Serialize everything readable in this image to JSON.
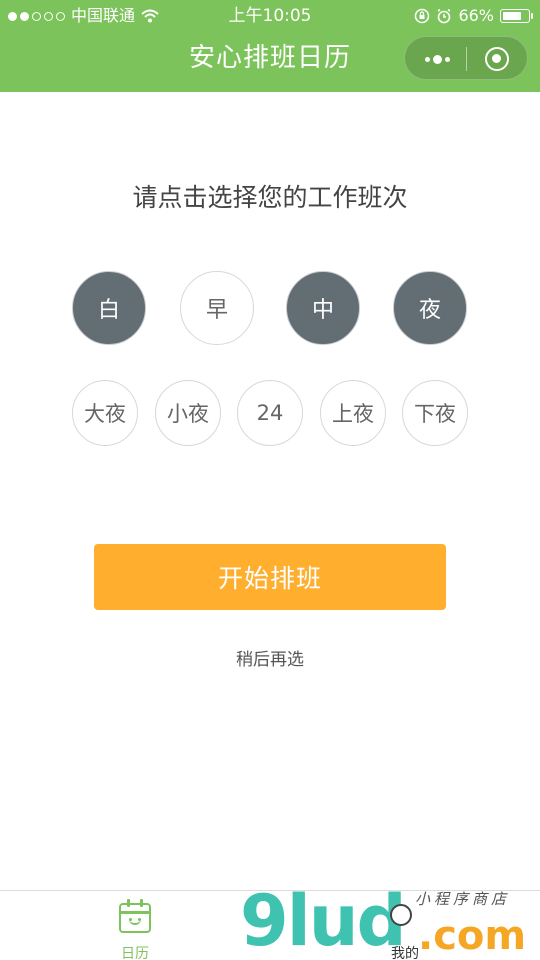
{
  "status_bar": {
    "carrier": "中国联通",
    "time": "上午10:05",
    "battery": "66%",
    "signal_bars_filled": 2,
    "signal_bars_total": 5
  },
  "nav": {
    "title": "安心排班日历"
  },
  "prompt": "请点击选择您的工作班次",
  "shifts_row1": [
    {
      "label": "白",
      "selected": true
    },
    {
      "label": "早",
      "selected": false
    },
    {
      "label": "中",
      "selected": true
    },
    {
      "label": "夜",
      "selected": true
    }
  ],
  "shifts_row2": [
    {
      "label": "大夜",
      "selected": false
    },
    {
      "label": "小夜",
      "selected": false
    },
    {
      "label": "24",
      "selected": false
    },
    {
      "label": "上夜",
      "selected": false
    },
    {
      "label": "下夜",
      "selected": false
    }
  ],
  "start_button": "开始排班",
  "later_link": "稍后再选",
  "tabbar": {
    "calendar": "日历",
    "me": "我的"
  },
  "watermark": {
    "brand": "9lud",
    "domain": ".com",
    "cn": "小程序商店"
  },
  "colors": {
    "nav_bg": "#7dc35b",
    "selected_bg": "#636d74",
    "start_button_bg": "#ffaf2d",
    "tab_active": "#7dc35b"
  }
}
